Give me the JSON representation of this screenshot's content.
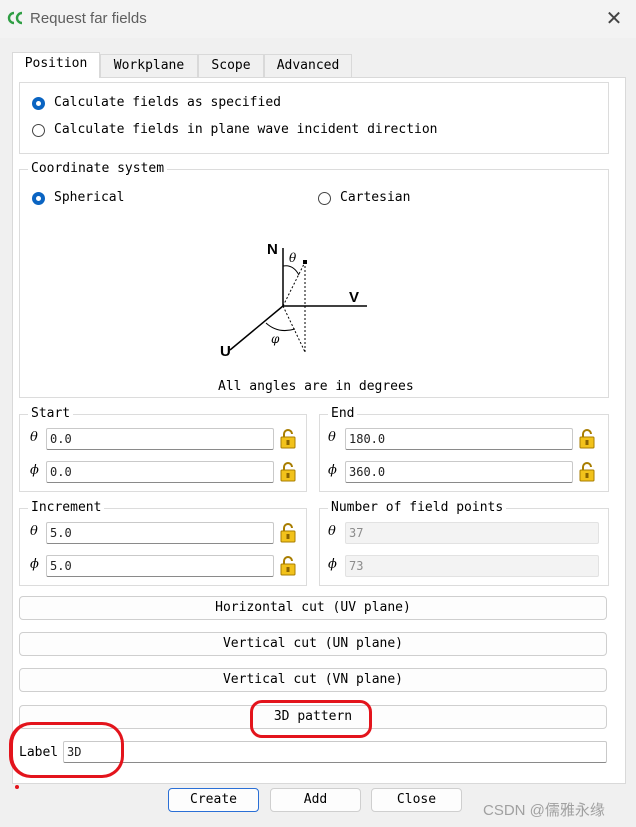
{
  "window": {
    "title": "Request far fields",
    "close": "✕"
  },
  "tabs": [
    "Position",
    "Workplane",
    "Scope",
    "Advanced"
  ],
  "calc_mode": {
    "option1": "Calculate fields as specified",
    "option2": "Calculate fields in plane wave incident direction"
  },
  "coord": {
    "title": "Coordinate system",
    "spherical": "Spherical",
    "cartesian": "Cartesian",
    "diagram": {
      "n": "N",
      "v": "V",
      "u": "U",
      "theta": "θ",
      "phi": "φ"
    },
    "note": "All angles are in degrees"
  },
  "start": {
    "title": "Start",
    "theta_sym": "θ",
    "phi_sym": "ϕ",
    "theta": "0.0",
    "phi": "0.0"
  },
  "end": {
    "title": "End",
    "theta_sym": "θ",
    "phi_sym": "ϕ",
    "theta": "180.0",
    "phi": "360.0"
  },
  "increment": {
    "title": "Increment",
    "theta_sym": "θ",
    "phi_sym": "ϕ",
    "theta": "5.0",
    "phi": "5.0"
  },
  "points": {
    "title": "Number of field points",
    "theta_sym": "θ",
    "phi_sym": "ϕ",
    "theta": "37",
    "phi": "73"
  },
  "cuts": {
    "horizontal": "Horizontal cut (UV plane)",
    "vertical_un": "Vertical cut (UN plane)",
    "vertical_vn": "Vertical cut (VN plane)",
    "pattern3d": "3D pattern"
  },
  "label": {
    "caption": "Label",
    "value": "3D"
  },
  "footer": {
    "create": "Create",
    "add": "Add",
    "close": "Close"
  },
  "watermark": "CSDN @儒雅永缘",
  "colors": {
    "accent": "#0a64c2",
    "annotation": "#e3141c",
    "lock": "#d9a400"
  }
}
